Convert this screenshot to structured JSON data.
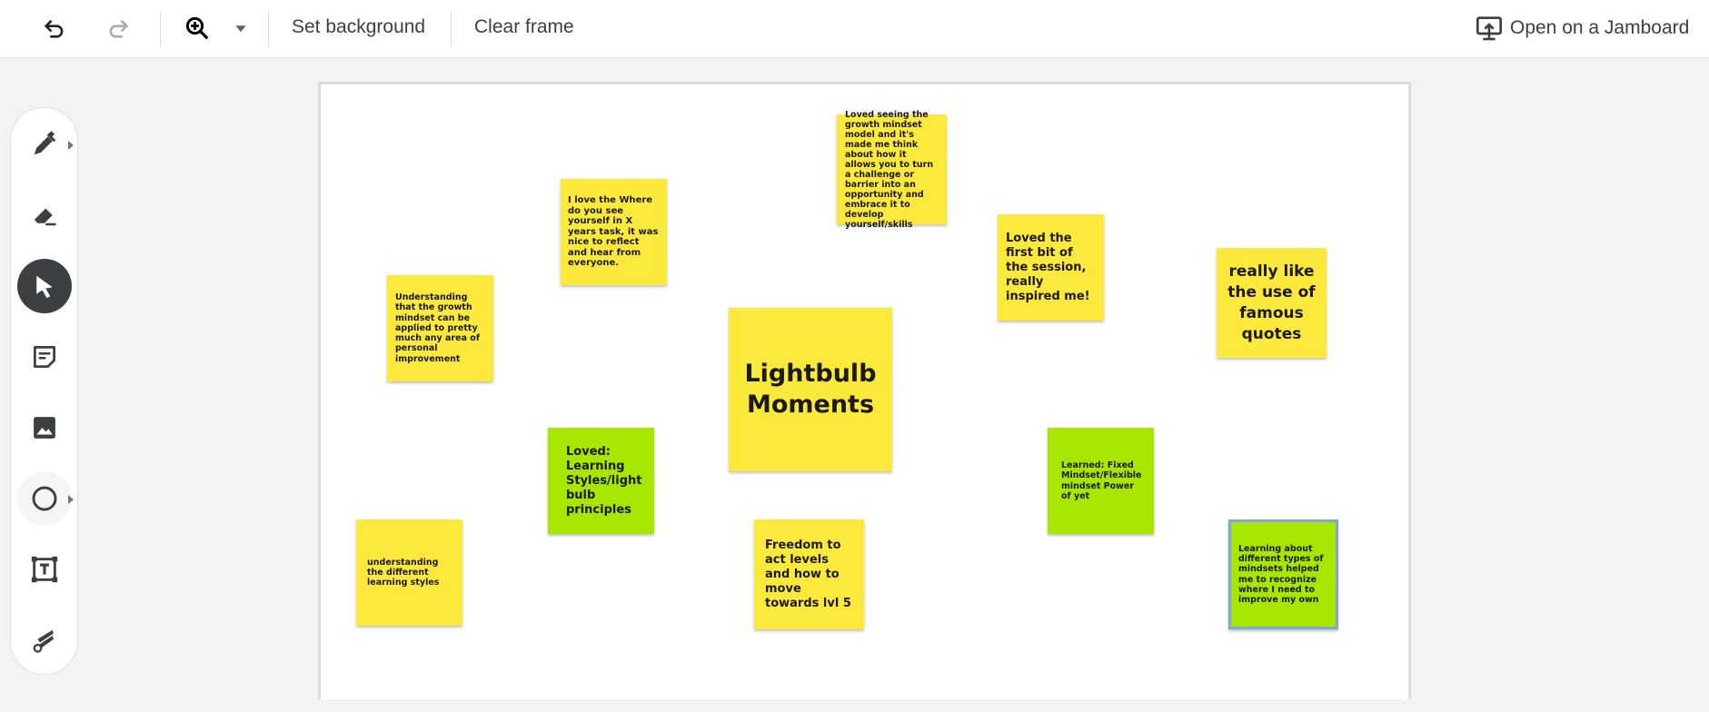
{
  "topbar": {
    "undo_icon": "undo-icon",
    "redo_icon": "redo-icon",
    "zoom_icon": "zoom-in-icon",
    "zoom_dropdown_icon": "caret-down-icon",
    "set_background_label": "Set background",
    "clear_frame_label": "Clear frame",
    "open_jamboard_label": "Open on a Jamboard",
    "open_jamboard_icon": "present-upload-icon"
  },
  "toolbar": {
    "tools": [
      {
        "name": "pen",
        "icon": "pen-icon",
        "has_submenu": true,
        "active": false
      },
      {
        "name": "eraser",
        "icon": "eraser-icon",
        "has_submenu": false,
        "active": false
      },
      {
        "name": "select",
        "icon": "cursor-icon",
        "has_submenu": false,
        "active": true
      },
      {
        "name": "sticky-note",
        "icon": "sticky-note-icon",
        "has_submenu": false,
        "active": false
      },
      {
        "name": "image",
        "icon": "image-icon",
        "has_submenu": false,
        "active": false
      },
      {
        "name": "shape",
        "icon": "circle-icon",
        "has_submenu": true,
        "active": false
      },
      {
        "name": "text-box",
        "icon": "text-box-icon",
        "has_submenu": false,
        "active": false
      },
      {
        "name": "laser",
        "icon": "laser-icon",
        "has_submenu": false,
        "active": false
      }
    ]
  },
  "colors": {
    "yellow_note": "#fde93c",
    "green_note": "#a8e600",
    "selection": "#7fa5dc",
    "active_tool": "#3c4043"
  },
  "notes": [
    {
      "text": "Loved seeing the growth mindset model and it's made me think about how it allows you to turn a challenge or barrier into an opportunity and embrace it to develop yourself/skills",
      "color": "yellow"
    },
    {
      "text": "I love the Where do you see yourself in X years task, it was nice to reflect and hear from everyone.",
      "color": "yellow"
    },
    {
      "text": "Loved the first bit of the session, really inspired me!",
      "color": "yellow"
    },
    {
      "text": "really like the use of famous quotes",
      "color": "yellow"
    },
    {
      "text": "Understanding that the growth mindset can be applied to pretty much any area of personal improvement",
      "color": "yellow"
    },
    {
      "text": "Lightbulb Moments",
      "color": "yellow"
    },
    {
      "text": "Loved: Learning Styles/light bulb principles",
      "color": "green"
    },
    {
      "text": "Learned: Fixed Mindset/Flexible mindset Power of yet",
      "color": "green"
    },
    {
      "text": "understanding the different learning styles",
      "color": "yellow"
    },
    {
      "text": "Freedom to act levels and how to move towards lvl 5",
      "color": "yellow"
    },
    {
      "text": "Learning about different types of mindsets helped me to recognize where I need to improve my own",
      "color": "green",
      "selected": true
    }
  ]
}
